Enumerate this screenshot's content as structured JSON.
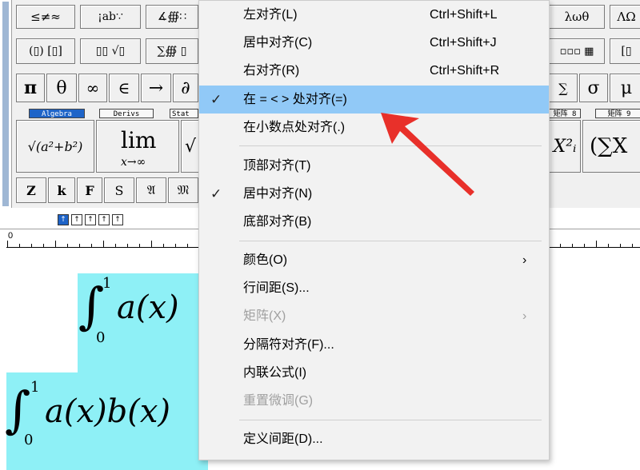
{
  "toolbar": {
    "row1": [
      "≤≠≈",
      "¡ab∵",
      "∡∰∷",
      "λωθ",
      "ΛΩ"
    ],
    "row2": [
      "(▯) [▯]",
      "▯▯ √▯",
      "∑∰ ▯",
      "▫▫▫ ▦",
      "[▯"
    ],
    "symbols": [
      "π",
      "θ",
      "∞",
      "∈",
      "→",
      "∂",
      "∑",
      "σ",
      "μ"
    ],
    "tabs": [
      "Algebra",
      "Derivs",
      "Stat",
      "矩阵 8",
      "矩阵 9"
    ],
    "templates": [
      "√(a²+b²)",
      "lim x→∞",
      "√",
      "X²ᵢ",
      "(∑X"
    ],
    "fonts": [
      "Z",
      "k",
      "F",
      "S",
      "𝔄",
      "𝔐"
    ],
    "align_buttons": [
      "↑",
      "↑",
      "↑",
      "↑",
      "↑"
    ],
    "ruler_zero": "0"
  },
  "context_menu": {
    "items": [
      {
        "label": "左对齐(L)",
        "shortcut": "Ctrl+Shift+L"
      },
      {
        "label": "居中对齐(C)",
        "shortcut": "Ctrl+Shift+J"
      },
      {
        "label": "右对齐(R)",
        "shortcut": "Ctrl+Shift+R"
      },
      {
        "label": "在 = < > 处对齐(=)",
        "checked": true,
        "highlighted": true
      },
      {
        "label": "在小数点处对齐(.)"
      },
      {
        "label": "顶部对齐(T)"
      },
      {
        "label": "居中对齐(N)",
        "checked": true
      },
      {
        "label": "底部对齐(B)"
      },
      {
        "label": "颜色(O)",
        "submenu": true
      },
      {
        "label": "行间距(S)..."
      },
      {
        "label": "矩阵(X)",
        "submenu": true,
        "disabled": true
      },
      {
        "label": "分隔符对齐(F)..."
      },
      {
        "label": "内联公式(I)"
      },
      {
        "label": "重置微调(G)",
        "disabled": true
      },
      {
        "label": "定义间距(D)..."
      }
    ],
    "check_mark": "✓",
    "submenu_arrow": "›"
  },
  "document": {
    "eq1": {
      "integral": "∫",
      "upper": "1",
      "lower": "0",
      "body": "a(x)"
    },
    "eq2": {
      "integral": "∫",
      "upper": "1",
      "lower": "0",
      "body": "a(x)b(x)"
    }
  },
  "colors": {
    "highlight": "#91c9f7",
    "selection": "#8ef0f6",
    "annotation_arrow": "#e8302a",
    "active_tab": "#1e64c8"
  }
}
